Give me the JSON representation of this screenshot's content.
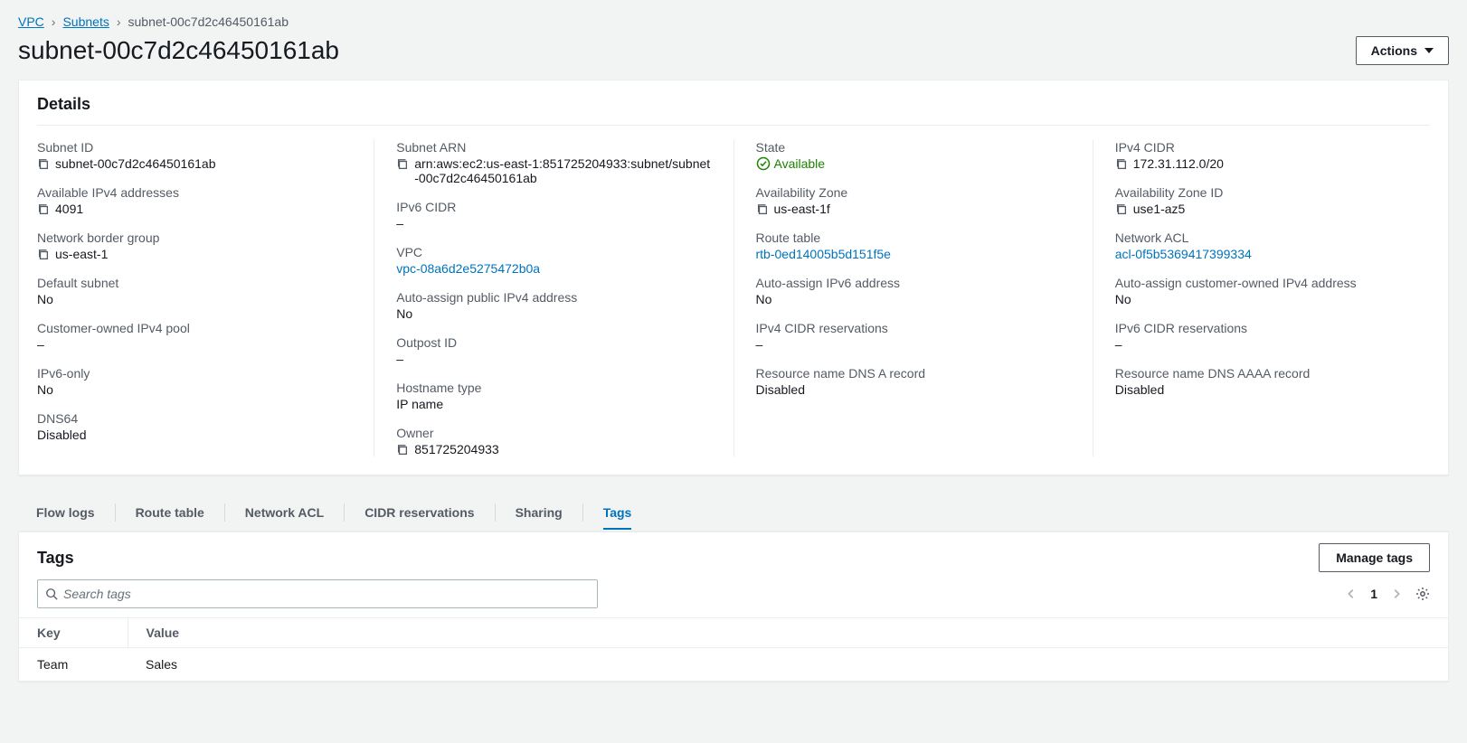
{
  "breadcrumb": {
    "vpc": "VPC",
    "subnets": "Subnets",
    "current": "subnet-00c7d2c46450161ab"
  },
  "header": {
    "title": "subnet-00c7d2c46450161ab",
    "actions_label": "Actions"
  },
  "details": {
    "panel_title": "Details",
    "col1": {
      "subnet_id": {
        "label": "Subnet ID",
        "value": "subnet-00c7d2c46450161ab"
      },
      "available_ipv4": {
        "label": "Available IPv4 addresses",
        "value": "4091"
      },
      "network_border_group": {
        "label": "Network border group",
        "value": "us-east-1"
      },
      "default_subnet": {
        "label": "Default subnet",
        "value": "No"
      },
      "customer_owned_ipv4_pool": {
        "label": "Customer-owned IPv4 pool",
        "value": "–"
      },
      "ipv6_only": {
        "label": "IPv6-only",
        "value": "No"
      },
      "dns64": {
        "label": "DNS64",
        "value": "Disabled"
      }
    },
    "col2": {
      "subnet_arn": {
        "label": "Subnet ARN",
        "value": "arn:aws:ec2:us-east-1:851725204933:subnet/subnet-00c7d2c46450161ab"
      },
      "ipv6_cidr": {
        "label": "IPv6 CIDR",
        "value": "–"
      },
      "vpc": {
        "label": "VPC",
        "value": "vpc-08a6d2e5275472b0a"
      },
      "auto_assign_public_ipv4": {
        "label": "Auto-assign public IPv4 address",
        "value": "No"
      },
      "outpost_id": {
        "label": "Outpost ID",
        "value": "–"
      },
      "hostname_type": {
        "label": "Hostname type",
        "value": "IP name"
      },
      "owner": {
        "label": "Owner",
        "value": "851725204933"
      }
    },
    "col3": {
      "state": {
        "label": "State",
        "value": "Available"
      },
      "az": {
        "label": "Availability Zone",
        "value": "us-east-1f"
      },
      "route_table": {
        "label": "Route table",
        "value": "rtb-0ed14005b5d151f5e"
      },
      "auto_assign_ipv6": {
        "label": "Auto-assign IPv6 address",
        "value": "No"
      },
      "ipv4_cidr_reservations": {
        "label": "IPv4 CIDR reservations",
        "value": "–"
      },
      "resource_dns_a": {
        "label": "Resource name DNS A record",
        "value": "Disabled"
      }
    },
    "col4": {
      "ipv4_cidr": {
        "label": "IPv4 CIDR",
        "value": "172.31.112.0/20"
      },
      "az_id": {
        "label": "Availability Zone ID",
        "value": "use1-az5"
      },
      "network_acl": {
        "label": "Network ACL",
        "value": "acl-0f5b5369417399334"
      },
      "auto_assign_customer_ipv4": {
        "label": "Auto-assign customer-owned IPv4 address",
        "value": "No"
      },
      "ipv6_cidr_reservations": {
        "label": "IPv6 CIDR reservations",
        "value": "–"
      },
      "resource_dns_aaaa": {
        "label": "Resource name DNS AAAA record",
        "value": "Disabled"
      }
    }
  },
  "tabs": {
    "flow_logs": "Flow logs",
    "route_table": "Route table",
    "network_acl": "Network ACL",
    "cidr_reservations": "CIDR reservations",
    "sharing": "Sharing",
    "tags": "Tags"
  },
  "tags_panel": {
    "title": "Tags",
    "manage_label": "Manage tags",
    "search_placeholder": "Search tags",
    "page_number": "1",
    "columns": {
      "key": "Key",
      "value": "Value"
    },
    "rows": [
      {
        "key": "Team",
        "value": "Sales"
      }
    ]
  }
}
